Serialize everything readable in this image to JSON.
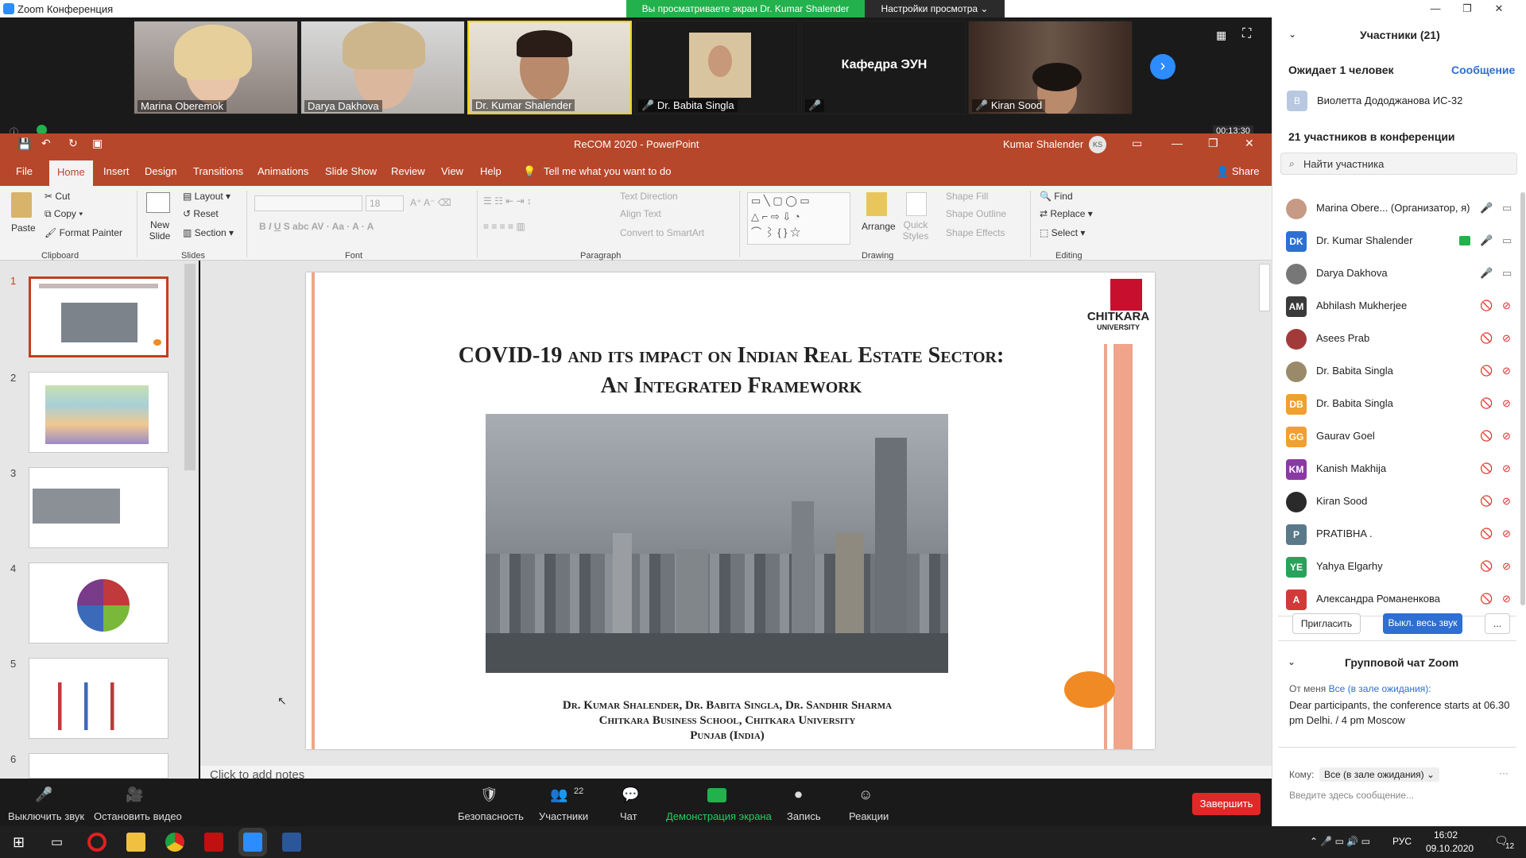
{
  "window": {
    "title": "Zoom Конференция",
    "share_status": "Вы просматриваете экран Dr. Kumar Shalender",
    "view_options": "Настройки просмотра ⌄",
    "timer": "00:13:30"
  },
  "videos": [
    {
      "name": "Marina Oberemok"
    },
    {
      "name": "Darya Dakhova"
    },
    {
      "name": "Dr. Kumar Shalender"
    },
    {
      "name": "Dr. Babita Singla"
    },
    {
      "name": "Кафедра ЭУН"
    },
    {
      "name": "Kiran Sood"
    }
  ],
  "ppt": {
    "title": "ReCOM 2020  -  PowerPoint",
    "user": "Kumar Shalender",
    "user_initials": "KS",
    "tabs": [
      "File",
      "Home",
      "Insert",
      "Design",
      "Transitions",
      "Animations",
      "Slide Show",
      "Review",
      "View",
      "Help"
    ],
    "tell_me": "Tell me what you want to do",
    "share": "Share",
    "ribbon": {
      "clipboard": {
        "paste": "Paste",
        "cut": "Cut",
        "copy": "Copy",
        "format_painter": "Format Painter",
        "group": "Clipboard"
      },
      "slides": {
        "new_slide": "New Slide",
        "layout": "Layout",
        "reset": "Reset",
        "section": "Section",
        "group": "Slides"
      },
      "font": {
        "size": "18",
        "group": "Font"
      },
      "paragraph": {
        "text_direction": "Text Direction",
        "align_text": "Align Text",
        "smartart": "Convert to SmartArt",
        "group": "Paragraph"
      },
      "drawing": {
        "arrange": "Arrange",
        "quick_styles": "Quick Styles",
        "shape_fill": "Shape Fill",
        "shape_outline": "Shape Outline",
        "shape_effects": "Shape Effects",
        "group": "Drawing"
      },
      "editing": {
        "find": "Find",
        "replace": "Replace",
        "select": "Select",
        "group": "Editing"
      }
    },
    "slide": {
      "title_line1": "COVID-19 and its impact on Indian Real Estate Sector:",
      "title_line2": "An Integrated Framework",
      "authors_line1": "Dr. Kumar Shalender, Dr. Babita Singla, Dr. Sandhir Sharma",
      "authors_line2": "Chitkara Business School, Chitkara University",
      "authors_line3": "Punjab (India)",
      "logo_text": "CHITKARA",
      "logo_sub": "UNIVERSITY"
    },
    "thumb_numbers": [
      "1",
      "2",
      "3",
      "4",
      "5",
      "6"
    ],
    "notes": "Click to add notes"
  },
  "zoom_toolbar": {
    "mute": "Выключить звук",
    "video": "Остановить видео",
    "security": "Безопасность",
    "participants": "Участники",
    "participants_count": "22",
    "chat": "Чат",
    "share": "Демонстрация экрана",
    "record": "Запись",
    "reactions": "Реакции",
    "end": "Завершить"
  },
  "panel": {
    "header": "Участники (21)",
    "waiting": "Ожидает 1 человек",
    "message_link": "Сообщение",
    "waiting_user": "Виолетта Дододжанова ИС-32",
    "waiting_initial": "В",
    "in_meeting": "21 участников в конференции",
    "search_placeholder": "Найти участника",
    "participants": [
      {
        "initials": "",
        "name": "Marina Obere... (Организатор, я)",
        "color": "#c79a86"
      },
      {
        "initials": "DK",
        "name": "Dr. Kumar Shalender",
        "color": "#2d6fd2"
      },
      {
        "initials": "",
        "name": "Darya Dakhova",
        "color": "#777777"
      },
      {
        "initials": "AM",
        "name": "Abhilash Mukherjee",
        "color": "#3a3a3a"
      },
      {
        "initials": "",
        "name": "Asees Prab",
        "color": "#a33a3a"
      },
      {
        "initials": "",
        "name": "Dr. Babita Singla",
        "color": "#9a8a6a"
      },
      {
        "initials": "DB",
        "name": "Dr. Babita Singla",
        "color": "#f0a030"
      },
      {
        "initials": "GG",
        "name": "Gaurav Goel",
        "color": "#f0a030"
      },
      {
        "initials": "KM",
        "name": "Kanish Makhija",
        "color": "#8a3aa3"
      },
      {
        "initials": "",
        "name": "Kiran Sood",
        "color": "#2a2a2a"
      },
      {
        "initials": "P",
        "name": "PRATIBHA .",
        "color": "#5a7a8a"
      },
      {
        "initials": "YE",
        "name": "Yahya Elgarhy",
        "color": "#2aa35a"
      },
      {
        "initials": "A",
        "name": "Александра Романенкова",
        "color": "#d23a3a"
      }
    ],
    "invite": "Пригласить",
    "mute_all": "Выкл. весь звук",
    "more": "...",
    "chat_header": "Групповой чат Zoom",
    "chat_from": "От меня",
    "chat_to": "Все (в зале ожидания):",
    "chat_message": "Dear participants, the conference starts at 06.30 pm Delhi. / 4 pm Moscow",
    "to_label": "Кому:",
    "to_value": "Все (в зале ожидания) ⌄",
    "input_placeholder": "Введите здесь сообщение..."
  },
  "taskbar": {
    "time": "16:02",
    "date": "09.10.2020",
    "lang": "РУС",
    "notifications": "12"
  }
}
